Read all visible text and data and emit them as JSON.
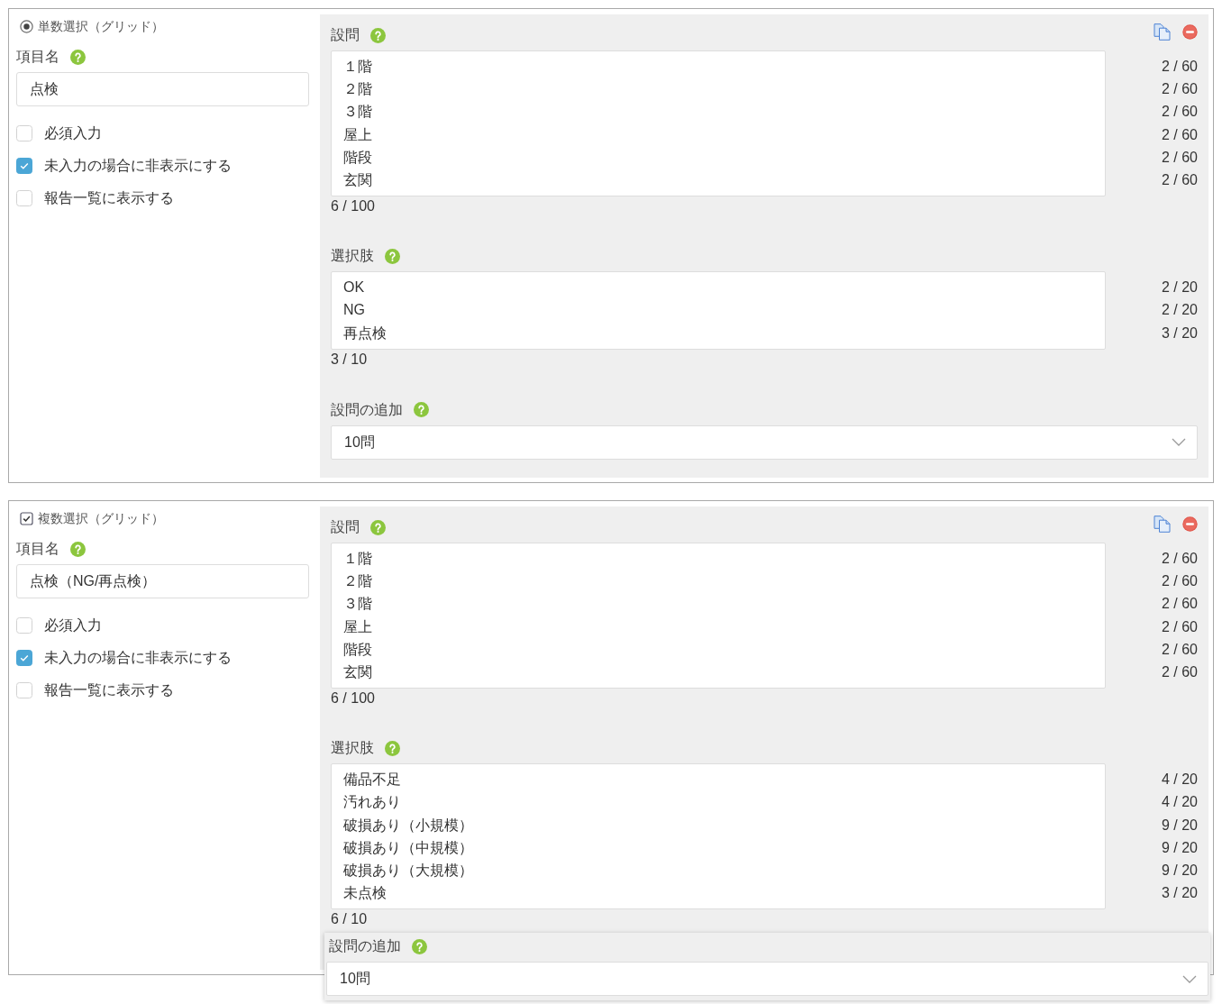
{
  "cards": [
    {
      "kind": "single",
      "type_label": "単数選択（グリッド）",
      "item_name": {
        "label": "項目名",
        "value": "点検"
      },
      "options": [
        {
          "label": "必須入力",
          "checked": false
        },
        {
          "label": "未入力の場合に非表示にする",
          "checked": true
        },
        {
          "label": "報告一覧に表示する",
          "checked": false
        }
      ],
      "questions": {
        "label": "設問",
        "lines": [
          {
            "text": "１階",
            "count": "2 / 60"
          },
          {
            "text": "２階",
            "count": "2 / 60"
          },
          {
            "text": "３階",
            "count": "2 / 60"
          },
          {
            "text": "屋上",
            "count": "2 / 60"
          },
          {
            "text": "階段",
            "count": "2 / 60"
          },
          {
            "text": "玄関",
            "count": "2 / 60"
          }
        ],
        "total": "6 / 100"
      },
      "choices": {
        "label": "選択肢",
        "lines": [
          {
            "text": "OK",
            "count": "2 / 20"
          },
          {
            "text": "NG",
            "count": "2 / 20"
          },
          {
            "text": "再点検",
            "count": "3 / 20"
          }
        ],
        "total": "3 / 10"
      },
      "add_question": {
        "label": "設問の追加",
        "value": "10問",
        "raised": false
      }
    },
    {
      "kind": "multiple",
      "type_label": "複数選択（グリッド）",
      "item_name": {
        "label": "項目名",
        "value": "点検（NG/再点検）"
      },
      "options": [
        {
          "label": "必須入力",
          "checked": false
        },
        {
          "label": "未入力の場合に非表示にする",
          "checked": true
        },
        {
          "label": "報告一覧に表示する",
          "checked": false
        }
      ],
      "questions": {
        "label": "設問",
        "lines": [
          {
            "text": "１階",
            "count": "2 / 60"
          },
          {
            "text": "２階",
            "count": "2 / 60"
          },
          {
            "text": "３階",
            "count": "2 / 60"
          },
          {
            "text": "屋上",
            "count": "2 / 60"
          },
          {
            "text": "階段",
            "count": "2 / 60"
          },
          {
            "text": "玄関",
            "count": "2 / 60"
          }
        ],
        "total": "6 / 100"
      },
      "choices": {
        "label": "選択肢",
        "lines": [
          {
            "text": "備品不足",
            "count": "4 / 20"
          },
          {
            "text": "汚れあり",
            "count": "4 / 20"
          },
          {
            "text": "破損あり（小規模）",
            "count": "9 / 20"
          },
          {
            "text": "破損あり（中規模）",
            "count": "9 / 20"
          },
          {
            "text": "破損あり（大規模）",
            "count": "9 / 20"
          },
          {
            "text": "未点検",
            "count": "3 / 20"
          }
        ],
        "total": "6 / 10"
      },
      "add_question": {
        "label": "設問の追加",
        "value": "10問",
        "raised": true
      }
    }
  ]
}
